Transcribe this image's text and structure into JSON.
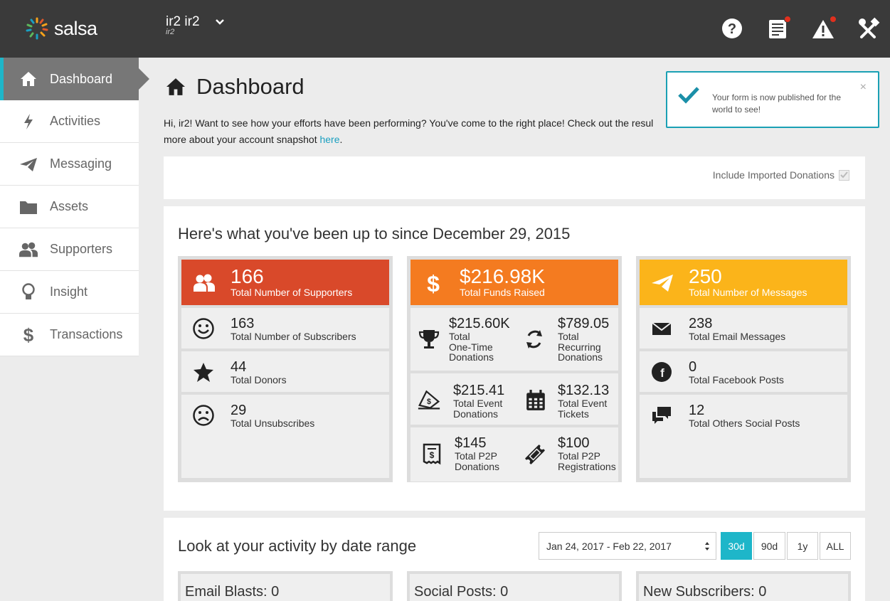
{
  "brand": {
    "logo_text": "salsa",
    "accent": "#1eb6c9"
  },
  "account": {
    "name": "ir2 ir2",
    "sub": "ir2"
  },
  "top_icons": [
    "help-icon",
    "reports-icon",
    "alert-icon",
    "tools-icon"
  ],
  "sidebar": {
    "items": [
      {
        "label": "Dashboard",
        "icon": "home-icon",
        "active": true
      },
      {
        "label": "Activities",
        "icon": "bolt-icon"
      },
      {
        "label": "Messaging",
        "icon": "paper-plane-icon"
      },
      {
        "label": "Assets",
        "icon": "folder-icon"
      },
      {
        "label": "Supporters",
        "icon": "people-icon"
      },
      {
        "label": "Insight",
        "icon": "lightbulb-icon"
      },
      {
        "label": "Transactions",
        "icon": "dollar-icon"
      }
    ]
  },
  "page": {
    "title": "Dashboard",
    "intro_text": "Hi, ir2! Want to see how your efforts have been performing? You've come to the right place! Check out the resul",
    "intro_text2": "more about your account snapshot ",
    "intro_link": "here",
    "intro_end": "."
  },
  "toast": {
    "message": "Your form is now published for the world to see!",
    "close": "×"
  },
  "filters": {
    "include_imported": "Include Imported Donations"
  },
  "summary": {
    "heading": "Here's what you've been up to since December 29, 2015",
    "supporters": {
      "color": "#d9492a",
      "value": "166",
      "label": "Total Number of Supporters",
      "rows": [
        {
          "value": "163",
          "label": "Total Number of Subscribers",
          "icon": "smiley-icon"
        },
        {
          "value": "44",
          "label": "Total Donors",
          "icon": "star-icon"
        },
        {
          "value": "29",
          "label": "Total Unsubscribes",
          "icon": "frown-icon"
        }
      ]
    },
    "funds": {
      "color": "#f47b20",
      "value": "$216.98K",
      "label": "Total Funds Raised",
      "rows": [
        [
          {
            "value": "$215.60K",
            "label": "Total One-Time Donations",
            "l1": "Total",
            "l2": "One-Time",
            "l3": "Donations",
            "icon": "trophy-icon"
          },
          {
            "value": "$789.05",
            "label": "Total Recurring Donations",
            "l1": "Total",
            "l2": "Recurring",
            "l3": "Donations",
            "icon": "recurring-icon"
          }
        ],
        [
          {
            "value": "$215.41",
            "l1": "Total Event",
            "l2": "Donations",
            "icon": "event-donation-icon"
          },
          {
            "value": "$132.13",
            "l1": "Total Event",
            "l2": "Tickets",
            "icon": "calendar-icon"
          }
        ],
        [
          {
            "value": "$145",
            "l1": "Total P2P",
            "l2": "Donations",
            "icon": "receipt-icon"
          },
          {
            "value": "$100",
            "l1": "Total P2P",
            "l2": "Registrations",
            "icon": "ticket-icon"
          }
        ]
      ]
    },
    "messages": {
      "color": "#fbb41a",
      "value": "250",
      "label": "Total Number of Messages",
      "rows": [
        {
          "value": "238",
          "label": "Total Email Messages",
          "icon": "envelope-icon"
        },
        {
          "value": "0",
          "label": "Total Facebook Posts",
          "icon": "facebook-icon"
        },
        {
          "value": "12",
          "label": "Total Others Social Posts",
          "icon": "chat-icon"
        }
      ]
    }
  },
  "activity": {
    "heading": "Look at your activity by date range",
    "range_value": "Jan 24, 2017 - Feb 22, 2017",
    "buttons": [
      "30d",
      "90d",
      "1y",
      "ALL"
    ],
    "active_button": "30d",
    "cards": [
      "Email Blasts: 0",
      "Social Posts: 0",
      "New Subscribers: 0"
    ]
  }
}
